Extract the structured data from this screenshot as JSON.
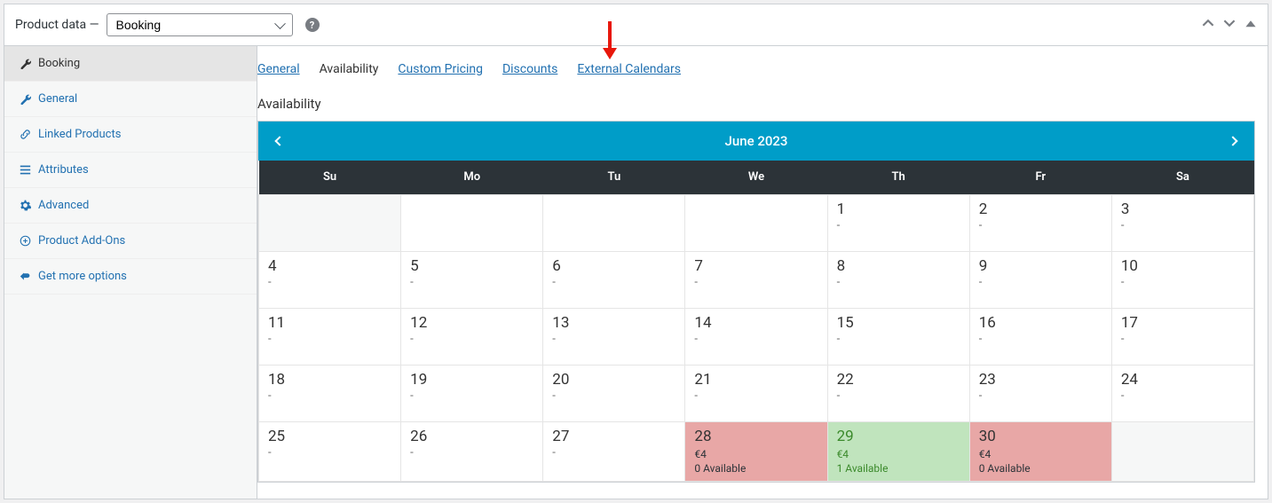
{
  "panel": {
    "title_prefix": "Product data",
    "title_sep": " — ",
    "product_type": "Booking"
  },
  "sidebar": {
    "items": [
      {
        "label": "Booking",
        "icon": "wrench"
      },
      {
        "label": "General",
        "icon": "wrench"
      },
      {
        "label": "Linked Products",
        "icon": "link"
      },
      {
        "label": "Attributes",
        "icon": "list"
      },
      {
        "label": "Advanced",
        "icon": "gear"
      },
      {
        "label": "Product Add-Ons",
        "icon": "plus"
      },
      {
        "label": "Get more options",
        "icon": "back"
      }
    ]
  },
  "subtabs": {
    "general": "General",
    "availability": "Availability",
    "custom_pricing": "Custom Pricing",
    "discounts": "Discounts",
    "external": "External Calendars"
  },
  "section_title": "Availability",
  "calendar": {
    "title": "June 2023",
    "weekdays": [
      "Su",
      "Mo",
      "Tu",
      "We",
      "Th",
      "Fr",
      "Sa"
    ],
    "weeks": [
      [
        {
          "day": "",
          "off": true
        },
        {
          "day": "",
          "avail": ""
        },
        {
          "day": "",
          "avail": ""
        },
        {
          "day": "",
          "avail": ""
        },
        {
          "day": "1",
          "avail": "-"
        },
        {
          "day": "2",
          "avail": "-"
        },
        {
          "day": "3",
          "avail": "-"
        }
      ],
      [
        {
          "day": "4",
          "avail": "-"
        },
        {
          "day": "5",
          "avail": "-"
        },
        {
          "day": "6",
          "avail": "-"
        },
        {
          "day": "7",
          "avail": "-"
        },
        {
          "day": "8",
          "avail": "-"
        },
        {
          "day": "9",
          "avail": "-"
        },
        {
          "day": "10",
          "avail": "-"
        }
      ],
      [
        {
          "day": "11",
          "avail": "-"
        },
        {
          "day": "12",
          "avail": "-"
        },
        {
          "day": "13",
          "avail": "-"
        },
        {
          "day": "14",
          "avail": "-"
        },
        {
          "day": "15",
          "avail": "-"
        },
        {
          "day": "16",
          "avail": "-"
        },
        {
          "day": "17",
          "avail": "-"
        }
      ],
      [
        {
          "day": "18",
          "avail": "-"
        },
        {
          "day": "19",
          "avail": "-"
        },
        {
          "day": "20",
          "avail": "-"
        },
        {
          "day": "21",
          "avail": "-"
        },
        {
          "day": "22",
          "avail": "-"
        },
        {
          "day": "23",
          "avail": "-"
        },
        {
          "day": "24",
          "avail": "-"
        }
      ],
      [
        {
          "day": "25",
          "avail": "-"
        },
        {
          "day": "26",
          "avail": "-"
        },
        {
          "day": "27",
          "avail": "-"
        },
        {
          "day": "28",
          "price": "€4",
          "availtxt": "0 Available",
          "status": "red"
        },
        {
          "day": "29",
          "price": "€4",
          "availtxt": "1 Available",
          "status": "green"
        },
        {
          "day": "30",
          "price": "€4",
          "availtxt": "0 Available",
          "status": "red"
        },
        {
          "day": "",
          "off": true
        }
      ]
    ]
  }
}
